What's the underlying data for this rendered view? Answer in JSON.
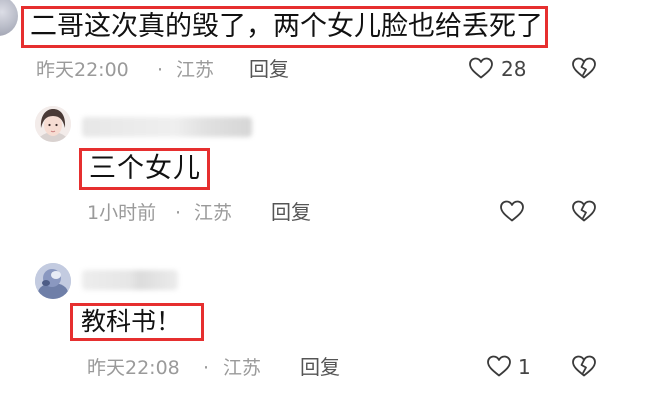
{
  "comments": [
    {
      "text": "二哥这次真的毁了，两个女儿脸也给丢死了",
      "time": "昨天22:00",
      "separator": "·",
      "location": "江苏",
      "reply_label": "回复",
      "like_count": "28"
    },
    {
      "text": "三个女儿",
      "time": "1小时前",
      "separator": "·",
      "location": "江苏",
      "reply_label": "回复",
      "like_count": ""
    },
    {
      "text": "教科书！",
      "time": "昨天22:08",
      "separator": "·",
      "location": "江苏",
      "reply_label": "回复",
      "like_count": "1"
    }
  ],
  "colors": {
    "highlight_border": "#e62f2f",
    "meta_text": "#9a9a9a",
    "icon_stroke": "#3a3a3a"
  },
  "icons": {
    "like": "heart-outline-icon",
    "dislike": "broken-heart-icon"
  }
}
